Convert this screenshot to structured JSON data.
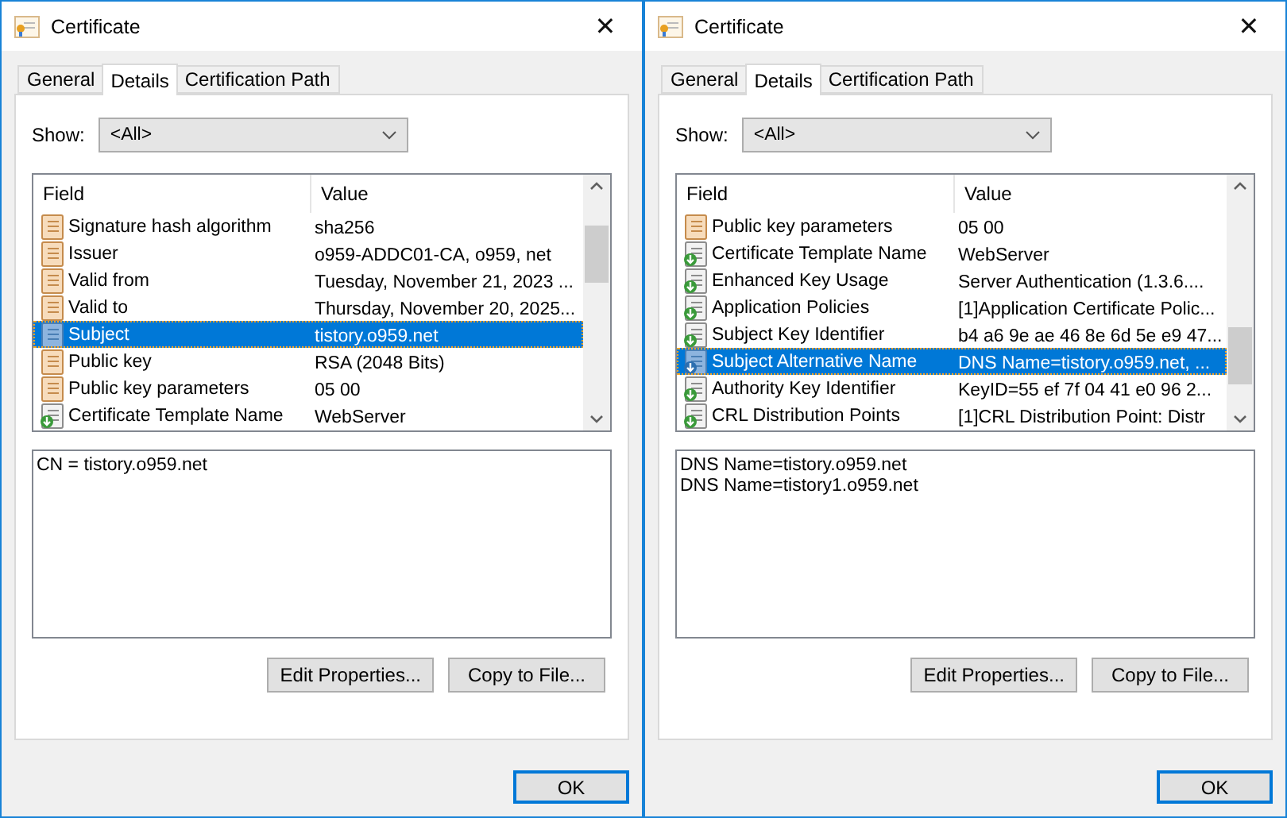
{
  "windows": [
    {
      "title": "Certificate",
      "close": "✕",
      "tabs": [
        {
          "label": "General",
          "selected": false
        },
        {
          "label": "Details",
          "selected": true
        },
        {
          "label": "Certification Path",
          "selected": false
        }
      ],
      "show": {
        "label": "Show:",
        "value": "<All>"
      },
      "columns": [
        "Field",
        "Value"
      ],
      "rows": [
        {
          "kind": "basic",
          "field": "Signature hash algorithm",
          "value": "sha256",
          "selected": false
        },
        {
          "kind": "basic",
          "field": "Issuer",
          "value": "o959-ADDC01-CA, o959, net",
          "selected": false
        },
        {
          "kind": "basic",
          "field": "Valid from",
          "value": "Tuesday, November 21, 2023 ...",
          "selected": false
        },
        {
          "kind": "basic",
          "field": "Valid to",
          "value": "Thursday, November 20, 2025...",
          "selected": false
        },
        {
          "kind": "basic",
          "field": "Subject",
          "value": "tistory.o959.net",
          "selected": true
        },
        {
          "kind": "basic",
          "field": "Public key",
          "value": "RSA (2048 Bits)",
          "selected": false
        },
        {
          "kind": "basic",
          "field": "Public key parameters",
          "value": "05 00",
          "selected": false
        },
        {
          "kind": "extension",
          "field": "Certificate Template Name",
          "value": "WebServer",
          "selected": false
        }
      ],
      "detail_lines": [
        "CN = tistory.o959.net"
      ],
      "buttons": [
        "Edit Properties...",
        "Copy to File..."
      ],
      "ok": "OK"
    },
    {
      "title": "Certificate",
      "close": "✕",
      "tabs": [
        {
          "label": "General",
          "selected": false
        },
        {
          "label": "Details",
          "selected": true
        },
        {
          "label": "Certification Path",
          "selected": false
        }
      ],
      "show": {
        "label": "Show:",
        "value": "<All>"
      },
      "columns": [
        "Field",
        "Value"
      ],
      "rows": [
        {
          "kind": "basic",
          "field": "Public key parameters",
          "value": "05 00",
          "selected": false
        },
        {
          "kind": "extension",
          "field": "Certificate Template Name",
          "value": "WebServer",
          "selected": false
        },
        {
          "kind": "extension",
          "field": "Enhanced Key Usage",
          "value": "Server Authentication (1.3.6....",
          "selected": false
        },
        {
          "kind": "extension",
          "field": "Application Policies",
          "value": "[1]Application Certificate Polic...",
          "selected": false
        },
        {
          "kind": "extension",
          "field": "Subject Key Identifier",
          "value": "b4 a6 9e ae 46 8e 6d 5e e9 47...",
          "selected": false
        },
        {
          "kind": "extension",
          "field": "Subject Alternative Name",
          "value": "DNS Name=tistory.o959.net, ...",
          "selected": true
        },
        {
          "kind": "extension",
          "field": "Authority Key Identifier",
          "value": "KeyID=55 ef 7f 04 41 e0 96 2...",
          "selected": false
        },
        {
          "kind": "extension",
          "field": "CRL Distribution Points",
          "value": "[1]CRL Distribution Point: Distr",
          "selected": false
        }
      ],
      "detail_lines": [
        "DNS Name=tistory.o959.net",
        "DNS Name=tistory1.o959.net"
      ],
      "buttons": [
        "Edit Properties...",
        "Copy to File..."
      ],
      "ok": "OK"
    }
  ]
}
